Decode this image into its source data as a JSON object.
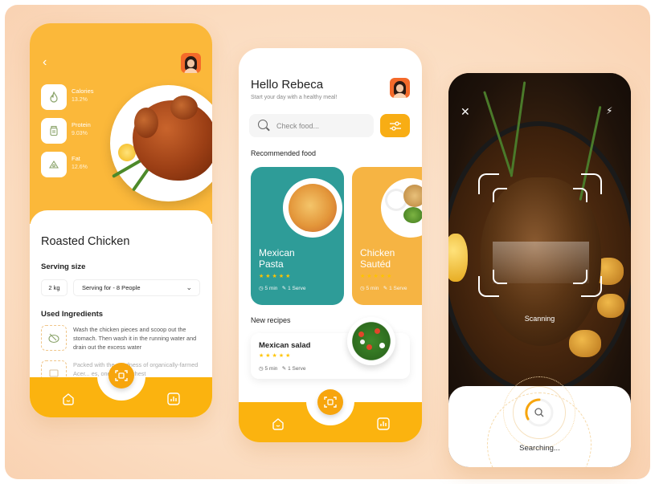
{
  "colors": {
    "accent": "#FBB83A",
    "teal": "#2E9C98",
    "orange_nav": "#FBB30F",
    "star": "#FFC400"
  },
  "screen1": {
    "back_icon": "chevron-left-icon",
    "nutrition": [
      {
        "label": "Calories",
        "value": "13.2%",
        "icon": "flame-icon"
      },
      {
        "label": "Protein",
        "value": "9.03%",
        "icon": "jar-icon"
      },
      {
        "label": "Fat",
        "value": "12.6%",
        "icon": "fat-icon"
      }
    ],
    "title": "Roasted Chicken",
    "serving_heading": "Serving size",
    "weight": "2 kg",
    "serving_select": "Serving for - 8 People",
    "ingredients_heading": "Used Ingredients",
    "ingredients": [
      {
        "text": "Wash the chicken pieces and scoop out the stomach. Then wash it in the running water and drain out the excess water"
      },
      {
        "text": "Packed with the goodness of organically-farmed Acer... es, one of the richest"
      }
    ]
  },
  "screen2": {
    "greeting": "Hello Rebeca",
    "subtitle": "Start your day with a healthy meal!",
    "search_placeholder": "Check food...",
    "recommended_heading": "Recommended food",
    "recommended": [
      {
        "name_line1": "Mexican",
        "name_line2": "Pasta",
        "stars": "★★★★★",
        "time": "5 min",
        "serve": "1 Serve"
      },
      {
        "name_line1": "Chicken",
        "name_line2": "Sautéd",
        "stars": "★★★★★",
        "time": "5 min",
        "serve": "1 Serve"
      }
    ],
    "new_heading": "New recipes",
    "new_recipe": {
      "name": "Mexican salad",
      "stars": "★★★★★",
      "time": "5 min",
      "serve": "1 Serve"
    }
  },
  "screen3": {
    "close_icon": "close-icon",
    "flash_icon": "flash-off-icon",
    "scanning": "Scanning",
    "searching": "Searching..."
  }
}
